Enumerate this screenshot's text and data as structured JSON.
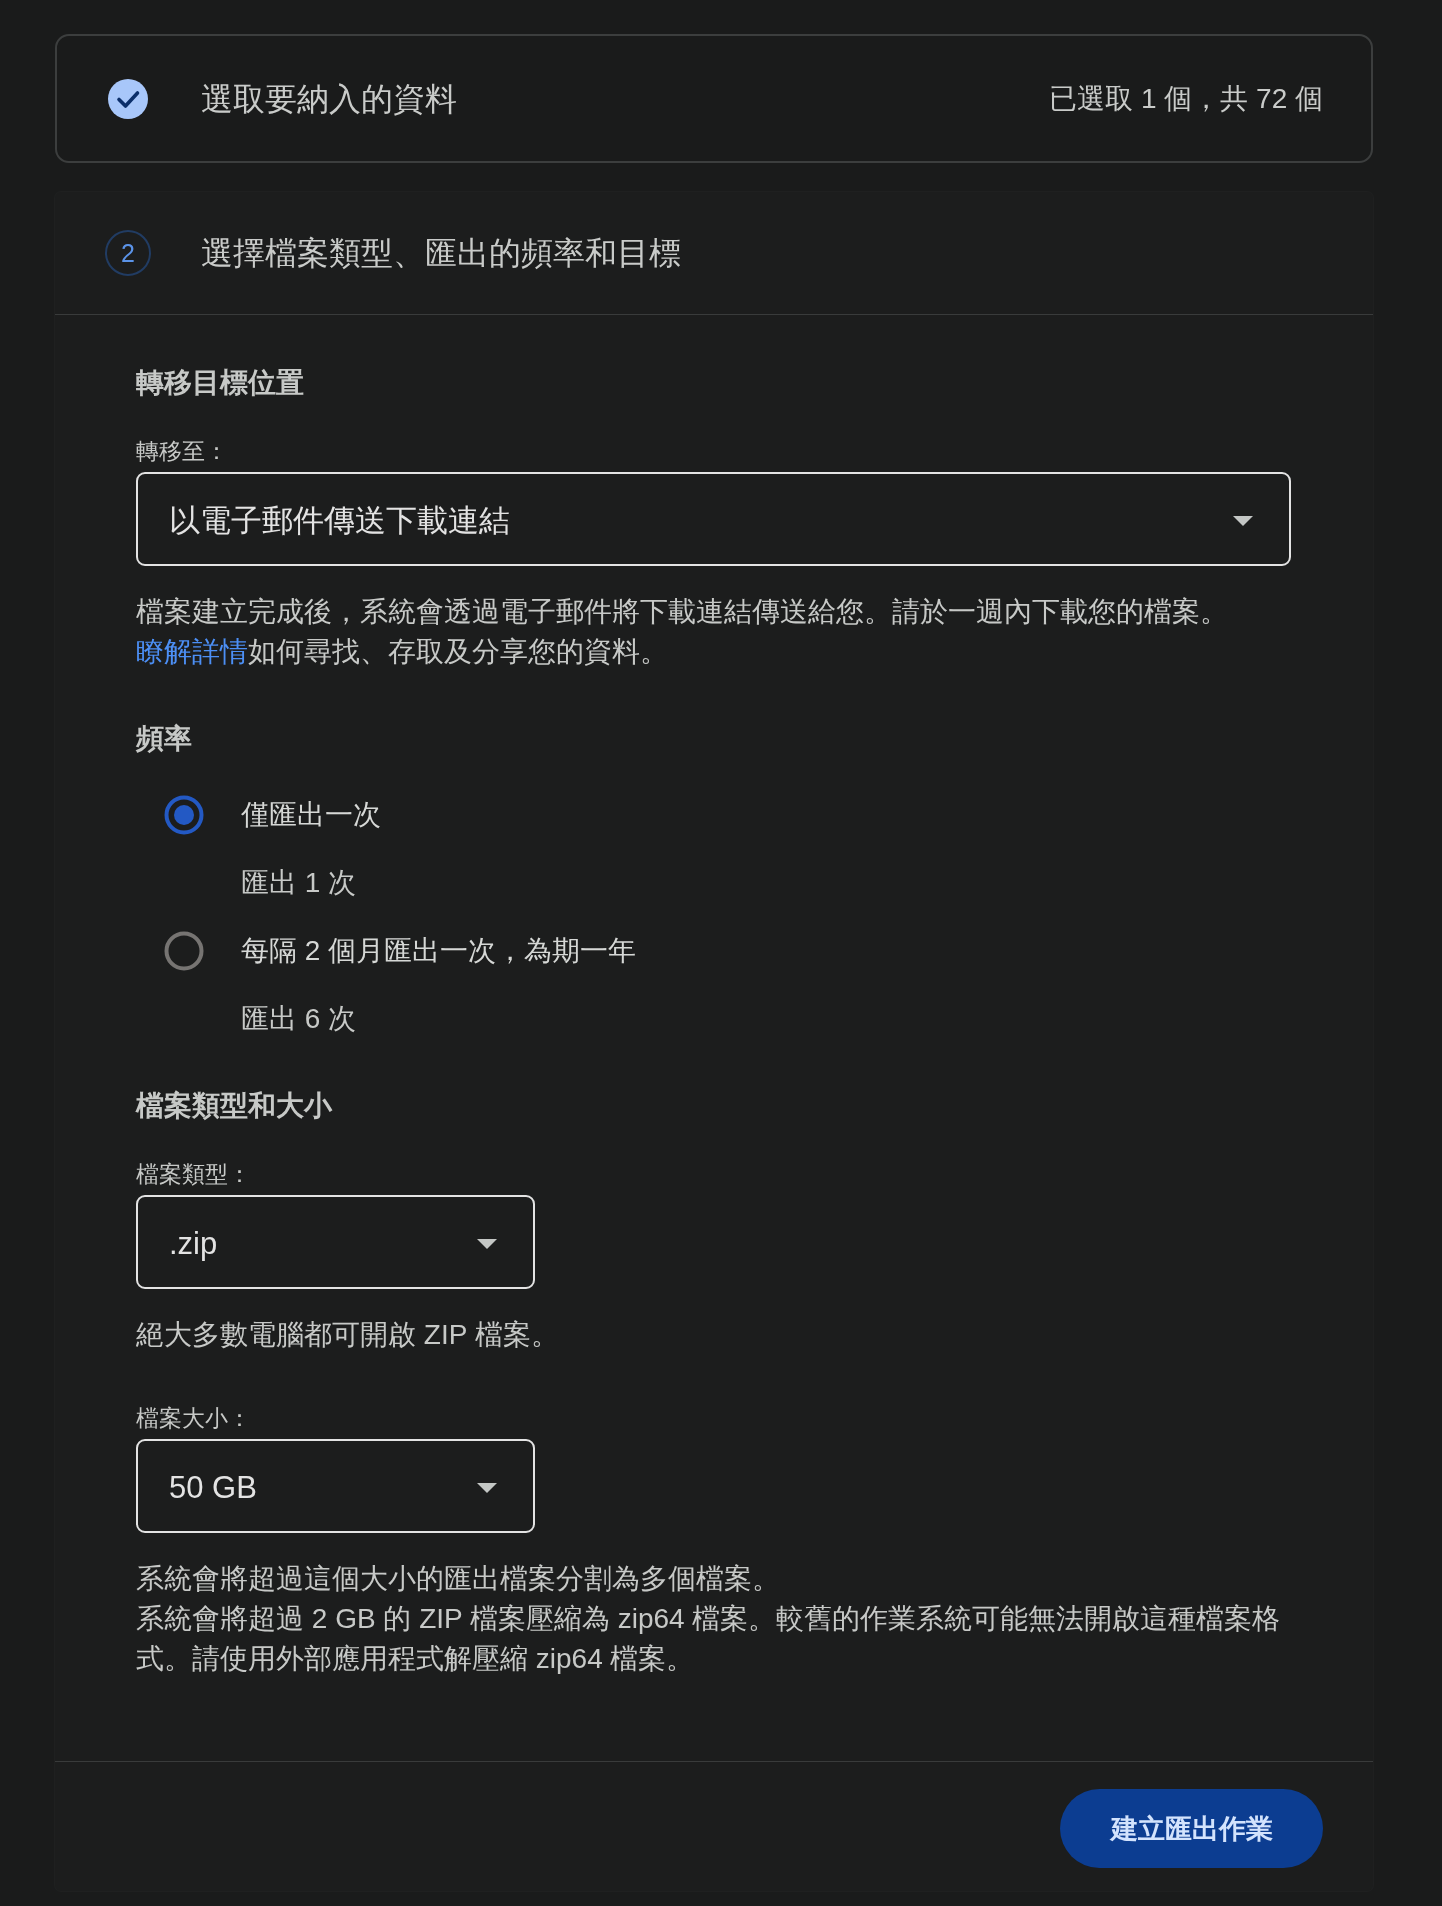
{
  "step_1": {
    "completed": true,
    "title": "選取要納入的資料",
    "summary": "已選取 1 個，共 72 個"
  },
  "step_2": {
    "number": "2",
    "title": "選擇檔案類型、匯出的頻率和目標"
  },
  "destination": {
    "heading": "轉移目標位置",
    "label": "轉移至：",
    "value": "以電子郵件傳送下載連結",
    "description_before": "檔案建立完成後，系統會透過電子郵件將下載連結傳送給您。請於一週內下載您的檔案。 ",
    "link": "瞭解詳情",
    "description_after": "如何尋找、存取及分享您的資料。"
  },
  "frequency": {
    "heading": "頻率",
    "options": [
      {
        "label": "僅匯出一次",
        "detail": "匯出 1 次",
        "selected": true
      },
      {
        "label": "每隔 2 個月匯出一次，為期一年",
        "detail": "匯出 6 次",
        "selected": false
      }
    ]
  },
  "file_type_and_size": {
    "heading": "檔案類型和大小",
    "fields": [
      {
        "label": "檔案類型：",
        "value": ".zip",
        "notes": [
          "絕大多數電腦都可開啟 ZIP 檔案。"
        ]
      },
      {
        "label": "檔案大小：",
        "value": "50 GB",
        "notes": [
          "系統會將超過這個大小的匯出檔案分割為多個檔案。",
          "系統會將超過 2 GB 的 ZIP 檔案壓縮為 zip64 檔案。較舊的作業系統可能無法開啟這種檔案格式。請使用外部應用程式解壓縮 zip64 檔案。"
        ]
      }
    ]
  },
  "footer": {
    "button": "建立匯出作業"
  }
}
